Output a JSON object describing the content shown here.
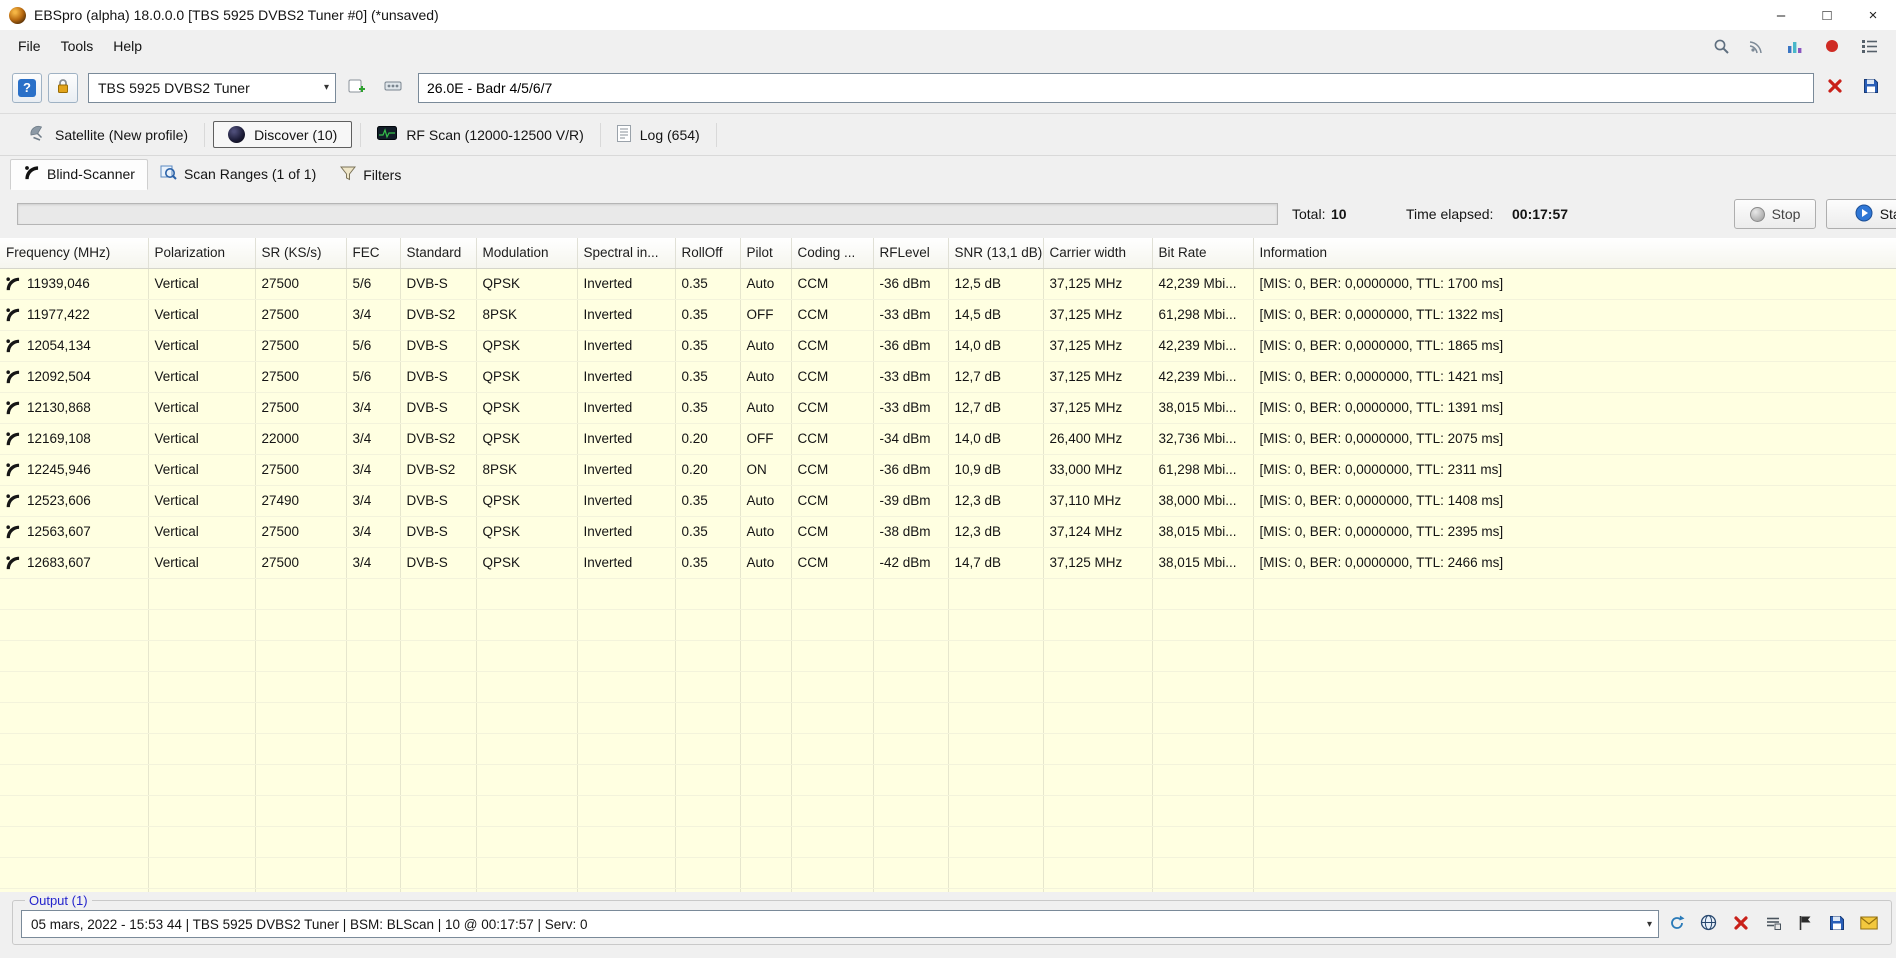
{
  "colors": {
    "row_bg": "#ffffe1",
    "accent_red": "#c9211a",
    "accent_blue": "#2a70c8",
    "legend_blue": "#2424cc",
    "window_bg": "#f0f0f0"
  },
  "glyphs": {
    "minimize": "–",
    "maximize": "□",
    "close": "×",
    "dropdown": "▾",
    "info": "?"
  },
  "window": {
    "title": "EBSpro (alpha) 18.0.0.0 [TBS 5925 DVBS2 Tuner #0] (*unsaved)"
  },
  "menu": {
    "file": "File",
    "tools": "Tools",
    "help": "Help"
  },
  "toolbar": {
    "tuner_select": "TBS 5925 DVBS2 Tuner",
    "profile_value": "26.0E - Badr 4/5/6/7"
  },
  "tabs_main": {
    "satellite": "Satellite (New profile)",
    "discover": "Discover (10)",
    "rf_scan": "RF Scan (12000-12500 V/R)",
    "log": "Log (654)"
  },
  "tabs_sub": {
    "blind_scanner": "Blind-Scanner",
    "scan_ranges": "Scan Ranges (1 of 1)",
    "filters": "Filters"
  },
  "scanbar": {
    "total_label": "Total:",
    "total_value": "10",
    "elapsed_label": "Time elapsed:",
    "elapsed_value": "00:17:57",
    "stop": "Stop",
    "start": "Start"
  },
  "table": {
    "columns": [
      "Frequency (MHz)",
      "Polarization",
      "SR (KS/s)",
      "FEC",
      "Standard",
      "Modulation",
      "Spectral in...",
      "RollOff",
      "Pilot",
      "Coding ...",
      "RFLevel",
      "SNR (13,1 dB)",
      "Carrier width",
      "Bit Rate",
      "Information"
    ],
    "rows": [
      [
        "11939,046",
        "Vertical",
        "27500",
        "5/6",
        "DVB-S",
        "QPSK",
        "Inverted",
        "0.35",
        "Auto",
        "CCM",
        "-36 dBm",
        "12,5 dB",
        "37,125 MHz",
        "42,239 Mbi...",
        "[MIS: 0, BER: 0,0000000, TTL: 1700 ms]"
      ],
      [
        "11977,422",
        "Vertical",
        "27500",
        "3/4",
        "DVB-S2",
        "8PSK",
        "Inverted",
        "0.35",
        "OFF",
        "CCM",
        "-33 dBm",
        "14,5 dB",
        "37,125 MHz",
        "61,298 Mbi...",
        "[MIS: 0, BER: 0,0000000, TTL: 1322 ms]"
      ],
      [
        "12054,134",
        "Vertical",
        "27500",
        "5/6",
        "DVB-S",
        "QPSK",
        "Inverted",
        "0.35",
        "Auto",
        "CCM",
        "-36 dBm",
        "14,0 dB",
        "37,125 MHz",
        "42,239 Mbi...",
        "[MIS: 0, BER: 0,0000000, TTL: 1865 ms]"
      ],
      [
        "12092,504",
        "Vertical",
        "27500",
        "5/6",
        "DVB-S",
        "QPSK",
        "Inverted",
        "0.35",
        "Auto",
        "CCM",
        "-33 dBm",
        "12,7 dB",
        "37,125 MHz",
        "42,239 Mbi...",
        "[MIS: 0, BER: 0,0000000, TTL: 1421 ms]"
      ],
      [
        "12130,868",
        "Vertical",
        "27500",
        "3/4",
        "DVB-S",
        "QPSK",
        "Inverted",
        "0.35",
        "Auto",
        "CCM",
        "-33 dBm",
        "12,7 dB",
        "37,125 MHz",
        "38,015 Mbi...",
        "[MIS: 0, BER: 0,0000000, TTL: 1391 ms]"
      ],
      [
        "12169,108",
        "Vertical",
        "22000",
        "3/4",
        "DVB-S2",
        "QPSK",
        "Inverted",
        "0.20",
        "OFF",
        "CCM",
        "-34 dBm",
        "14,0 dB",
        "26,400 MHz",
        "32,736 Mbi...",
        "[MIS: 0, BER: 0,0000000, TTL: 2075 ms]"
      ],
      [
        "12245,946",
        "Vertical",
        "27500",
        "3/4",
        "DVB-S2",
        "8PSK",
        "Inverted",
        "0.20",
        "ON",
        "CCM",
        "-36 dBm",
        "10,9 dB",
        "33,000 MHz",
        "61,298 Mbi...",
        "[MIS: 0, BER: 0,0000000, TTL: 2311 ms]"
      ],
      [
        "12523,606",
        "Vertical",
        "27490",
        "3/4",
        "DVB-S",
        "QPSK",
        "Inverted",
        "0.35",
        "Auto",
        "CCM",
        "-39 dBm",
        "12,3 dB",
        "37,110 MHz",
        "38,000 Mbi...",
        "[MIS: 0, BER: 0,0000000, TTL: 1408 ms]"
      ],
      [
        "12563,607",
        "Vertical",
        "27500",
        "3/4",
        "DVB-S",
        "QPSK",
        "Inverted",
        "0.35",
        "Auto",
        "CCM",
        "-38 dBm",
        "12,3 dB",
        "37,124 MHz",
        "38,015 Mbi...",
        "[MIS: 0, BER: 0,0000000, TTL: 2395 ms]"
      ],
      [
        "12683,607",
        "Vertical",
        "27500",
        "3/4",
        "DVB-S",
        "QPSK",
        "Inverted",
        "0.35",
        "Auto",
        "CCM",
        "-42 dBm",
        "14,7 dB",
        "37,125 MHz",
        "38,015 Mbi...",
        "[MIS: 0, BER: 0,0000000, TTL: 2466 ms]"
      ]
    ]
  },
  "output": {
    "label": "Output (1)",
    "value": "05 mars, 2022 - 15:53 44 | TBS 5925 DVBS2 Tuner | BSM: BLScan | 10 @ 00:17:57 | Serv: 0"
  }
}
